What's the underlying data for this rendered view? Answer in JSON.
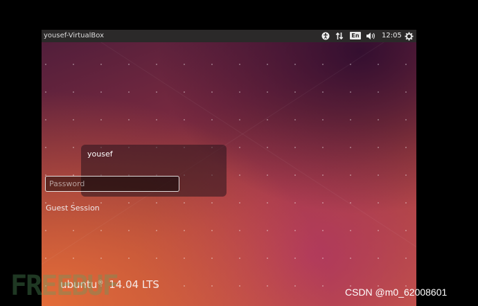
{
  "panel": {
    "hostname": "yousef-VirtualBox",
    "keyboard_layout": "En",
    "time": "12:05",
    "icons": [
      "accessibility-icon",
      "network-icon",
      "volume-icon",
      "settings-gear-icon"
    ]
  },
  "login": {
    "user_name": "yousef",
    "password_placeholder": "Password",
    "guest_label": "Guest Session"
  },
  "branding": {
    "logo_text": "ubuntu",
    "registered_mark": "®",
    "version": "14.04 LTS"
  },
  "watermark": {
    "csdn_text": "CSDN @m0_62008601",
    "left_text": "FREEBUF"
  },
  "colors": {
    "panel_bg": "#2b2929",
    "wallpaper_dark": "#4e1d3a",
    "wallpaper_orange": "#c85a44"
  }
}
